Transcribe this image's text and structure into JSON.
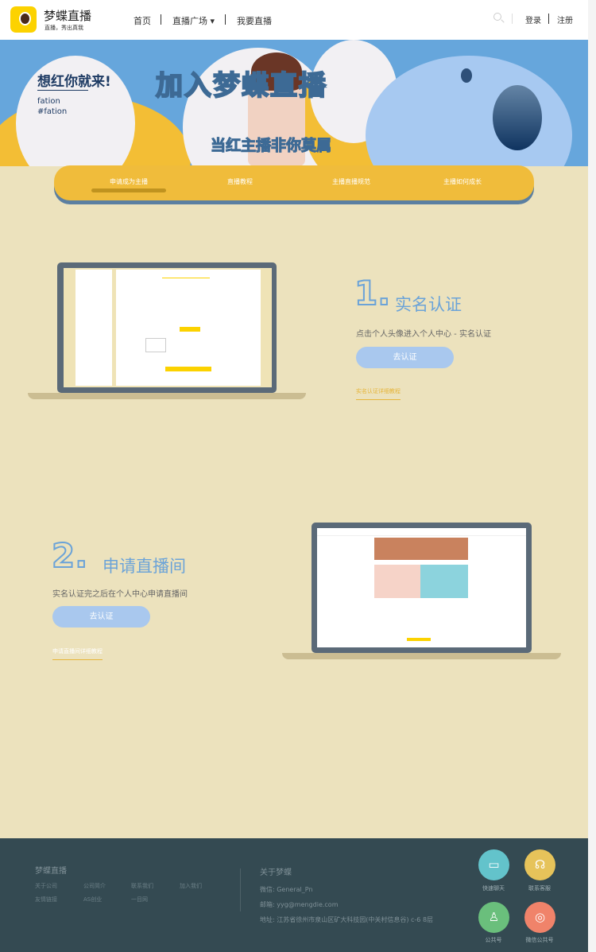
{
  "header": {
    "brand": "梦蝶直播",
    "slogan": "直播，秀出真我",
    "nav": [
      "首页",
      "直播广场 ▾",
      "我要直播"
    ],
    "login": "登录",
    "register": "注册"
  },
  "banner": {
    "title": "加入梦蝶直播",
    "subtitle": "当红主播非你莫属",
    "left_title": "想红你就来!",
    "tag1": "fation",
    "tag2": "#fation"
  },
  "tabs": [
    "申请成为主播",
    "直播教程",
    "主播直播规范",
    "主播如何成长"
  ],
  "step1": {
    "num": "1.",
    "title": "实名认证",
    "desc": "点击个人头像进入个人中心 - 实名认证",
    "button": "去认证",
    "link": "实名认证详细教程"
  },
  "step2": {
    "num": "2.",
    "title": "申请直播间",
    "desc": "实名认证完之后在个人中心申请直播间",
    "button": "去认证",
    "link": "申请直播间详细教程"
  },
  "footer": {
    "brand": "梦蝶直播",
    "links": [
      "关于公司",
      "公司简介",
      "联系我们",
      "加入我们",
      "友情链接",
      "AS创业",
      "一目网"
    ],
    "about_title": "关于梦蝶",
    "wechat": "微信: General_Pn",
    "email": "邮箱: yyg@mengdie.com",
    "address": "地址: 江苏省徐州市泉山区矿大科技园(中关村信息谷) c-6 8层",
    "icons": [
      {
        "label": "快速聊天",
        "color": "#63c3cb",
        "icon": "chat-icon"
      },
      {
        "label": "联系客服",
        "color": "#e6c35a",
        "icon": "headset-icon"
      },
      {
        "label": "公共号",
        "color": "#6abf7c",
        "icon": "user-icon"
      },
      {
        "label": "微信公共号",
        "color": "#f0836a",
        "icon": "wechat-icon"
      }
    ]
  }
}
